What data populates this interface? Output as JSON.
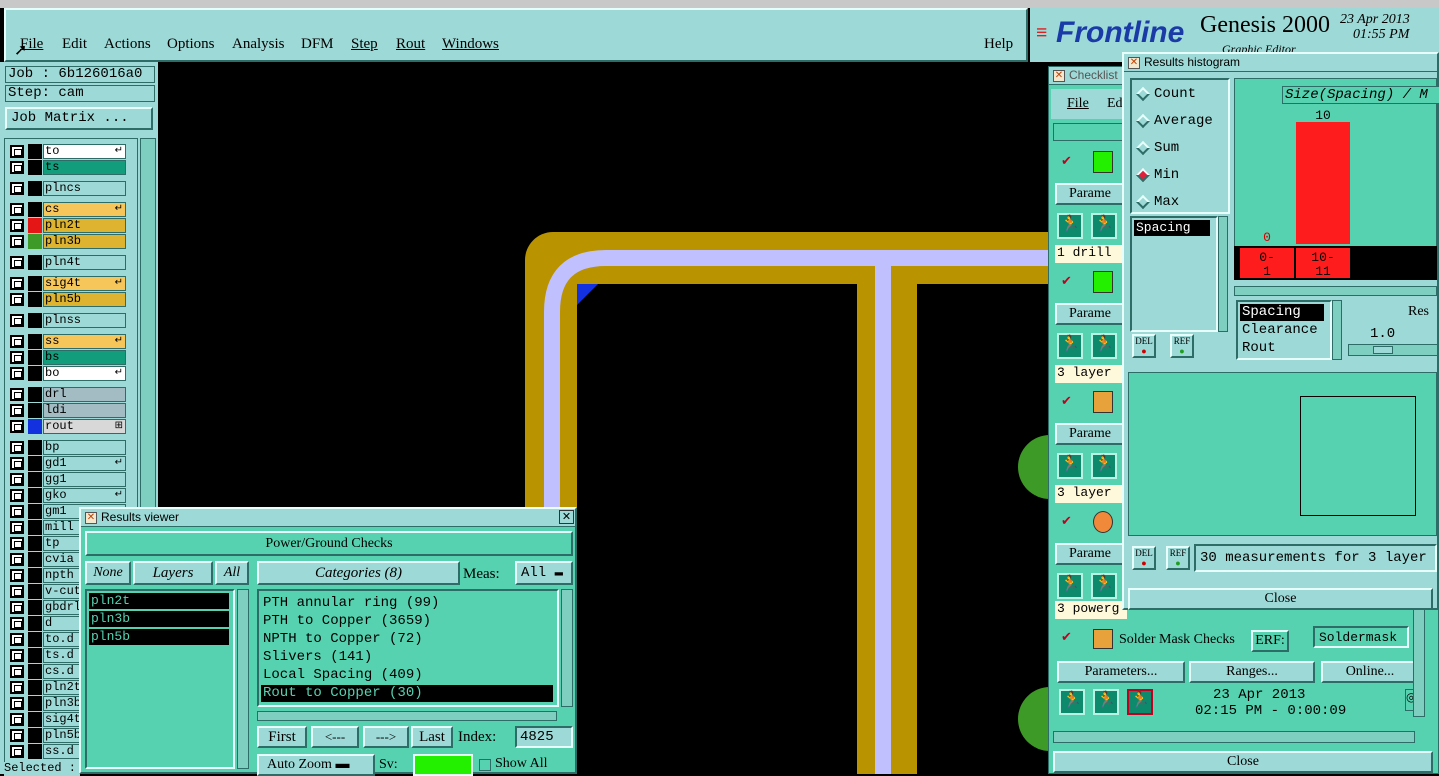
{
  "menu": {
    "items": [
      "File",
      "Edit",
      "Actions",
      "Options",
      "Analysis",
      "DFM",
      "Step",
      "Rout",
      "Windows"
    ],
    "help": "Help"
  },
  "brand": {
    "logo": "Frontline",
    "product": "Genesis 2000",
    "subtitle": "Graphic Editor",
    "date": "23 Apr 2013",
    "time": "01:55 PM"
  },
  "job": {
    "job_label": "Job : 6b126016a0",
    "step_label": "Step: cam",
    "matrix_button": "Job Matrix ..."
  },
  "layers": [
    {
      "name": "to",
      "bg": "#ffffff",
      "sw": "",
      "mark": "↵"
    },
    {
      "name": "ts",
      "bg": "#129e7d",
      "sw": "",
      "mark": ""
    },
    {
      "name": "plncs",
      "bg": "#9dd9d6",
      "sw": "",
      "mark": ""
    },
    {
      "name": "cs",
      "bg": "#f7c65a",
      "sw": "",
      "mark": "↵"
    },
    {
      "name": "pln2t",
      "bg": "#ddb32f",
      "sw": "#e41616",
      "mark": ""
    },
    {
      "name": "pln3b",
      "bg": "#ddb32f",
      "sw": "#3e9a27",
      "mark": ""
    },
    {
      "name": "pln4t",
      "bg": "#9dd9d6",
      "sw": "",
      "mark": ""
    },
    {
      "name": "sig4t",
      "bg": "#f7c65a",
      "sw": "",
      "mark": "↵"
    },
    {
      "name": "pln5b",
      "bg": "#ddb32f",
      "sw": "",
      "mark": ""
    },
    {
      "name": "plnss",
      "bg": "#9dd9d6",
      "sw": "",
      "mark": ""
    },
    {
      "name": "ss",
      "bg": "#f7c65a",
      "sw": "",
      "mark": "↵"
    },
    {
      "name": "bs",
      "bg": "#129e7d",
      "sw": "",
      "mark": ""
    },
    {
      "name": "bo",
      "bg": "#ffffff",
      "sw": "",
      "mark": "↵"
    },
    {
      "name": "drl",
      "bg": "#a3bcc4",
      "sw": "",
      "mark": ""
    },
    {
      "name": "ldi",
      "bg": "#a3bcc4",
      "sw": "",
      "mark": ""
    },
    {
      "name": "rout",
      "bg": "#d8d8d8",
      "sw": "#1431e0",
      "mark": "⊞"
    },
    {
      "name": "bp",
      "bg": "#9dd9d6",
      "sw": "",
      "mark": ""
    },
    {
      "name": "gd1",
      "bg": "#9dd9d6",
      "sw": "",
      "mark": "↵"
    },
    {
      "name": "gg1",
      "bg": "#9dd9d6",
      "sw": "",
      "mark": ""
    },
    {
      "name": "gko",
      "bg": "#9dd9d6",
      "sw": "",
      "mark": "↵"
    },
    {
      "name": "gm1",
      "bg": "#9dd9d6",
      "sw": "",
      "mark": ""
    },
    {
      "name": "mill",
      "bg": "#9dd9d6",
      "sw": "",
      "mark": ""
    },
    {
      "name": "tp",
      "bg": "#9dd9d6",
      "sw": "",
      "mark": ""
    },
    {
      "name": "cvia",
      "bg": "#9dd9d6",
      "sw": "",
      "mark": ""
    },
    {
      "name": "npth",
      "bg": "#9dd9d6",
      "sw": "",
      "mark": ""
    },
    {
      "name": "v-cut",
      "bg": "#9dd9d6",
      "sw": "",
      "mark": ""
    },
    {
      "name": "gbdrl",
      "bg": "#9dd9d6",
      "sw": "",
      "mark": ""
    },
    {
      "name": "d",
      "bg": "#9dd9d6",
      "sw": "",
      "mark": ""
    },
    {
      "name": "to.d",
      "bg": "#9dd9d6",
      "sw": "",
      "mark": ""
    },
    {
      "name": "ts.d",
      "bg": "#9dd9d6",
      "sw": "",
      "mark": ""
    },
    {
      "name": "cs.d",
      "bg": "#9dd9d6",
      "sw": "",
      "mark": ""
    },
    {
      "name": "pln2t",
      "bg": "#9dd9d6",
      "sw": "",
      "mark": ""
    },
    {
      "name": "pln3b",
      "bg": "#9dd9d6",
      "sw": "",
      "mark": ""
    },
    {
      "name": "sig4t",
      "bg": "#9dd9d6",
      "sw": "",
      "mark": ""
    },
    {
      "name": "pln5b",
      "bg": "#9dd9d6",
      "sw": "",
      "mark": ""
    },
    {
      "name": "ss.d",
      "bg": "#9dd9d6",
      "sw": "",
      "mark": ""
    }
  ],
  "selected_label": "Selected :",
  "results_viewer": {
    "title": "Results viewer",
    "header": "Power/Ground Checks",
    "none": "None",
    "layers": "Layers",
    "all": "All",
    "categories_label": "Categories (8)",
    "meas_label": "Meas:",
    "meas_value": "All",
    "layer_list": [
      "pln2t",
      "pln3b",
      "pln5b"
    ],
    "category_list": [
      "PTH annular ring (99)",
      "PTH to Copper (3659)",
      "NPTH to Copper (72)",
      "Slivers (141)",
      "Local Spacing (409)",
      "Rout to Copper (30)"
    ],
    "first": "First",
    "prev": "<---",
    "next": "--->",
    "last": "Last",
    "index_label": "Index:",
    "index_value": "4825",
    "auto_zoom": "Auto Zoom",
    "sv_label": "Sv:",
    "show_all": "Show All"
  },
  "checklist": {
    "title": "Checklist",
    "file": "File",
    "edit": "Ed",
    "params": "Parame",
    "row_drill": "1 drill",
    "row_layer1": "3 layer",
    "row_layer2": "3 layer",
    "row_power": "3 powerg",
    "solder_title": "Solder Mask Checks",
    "erf_label": "ERF:",
    "erf_value": "Soldermask",
    "parameters": "Parameters...",
    "ranges": "Ranges...",
    "online": "Online...",
    "run_date": "23 Apr 2013",
    "run_time": "02:15 PM - 0:00:09",
    "close": "Close"
  },
  "histogram": {
    "title": "Results histogram",
    "radios": [
      "Count",
      "Average",
      "Sum",
      "Min",
      "Max"
    ],
    "selected": "Min",
    "list_top": [
      "Spacing"
    ],
    "list_bottom": [
      "Spacing",
      "Clearance",
      "Rout"
    ],
    "del": "DEL",
    "ref": "REF",
    "chart_title": "Size(Spacing) / M",
    "res_label": "Res",
    "res_value": "1.0",
    "status": "30 measurements for 3 layer",
    "close": "Close"
  },
  "chart_data": {
    "type": "bar",
    "title": "Size(Spacing) / M",
    "categories": [
      "0-1",
      "10-11"
    ],
    "values": [
      0,
      10
    ],
    "color": "#ff1c1c"
  }
}
